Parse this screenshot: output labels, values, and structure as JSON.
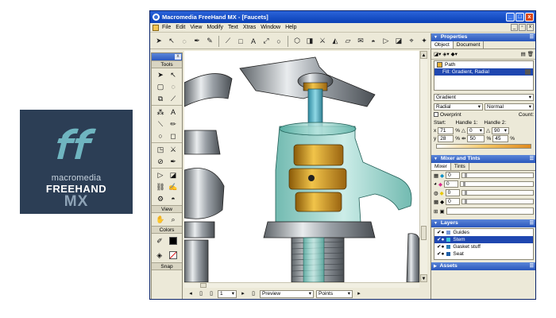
{
  "logo": {
    "line1": "macromedia",
    "line2": "FREEHAND",
    "line3": "MX"
  },
  "window": {
    "title": "Macromedia FreeHand MX - [Faucets]",
    "minimize": "_",
    "maximize": "□",
    "close": "x"
  },
  "menu": [
    "File",
    "Edit",
    "View",
    "Modify",
    "Text",
    "Xtras",
    "Window",
    "Help"
  ],
  "toolbar_icons": [
    "pointer-icon",
    "subselect-icon",
    "lasso-icon",
    "pen-icon",
    "freeform-icon",
    "eyedropper-icon",
    "rectangle-icon",
    "text-icon",
    "scale-icon",
    "ellipse-icon",
    "polygon-icon",
    "extrude-icon",
    "knife-icon",
    "reflect-icon",
    "skew-icon",
    "envelope-icon",
    "bucket-icon",
    "perspective-icon",
    "fill-icon",
    "trace-icon"
  ],
  "tools": {
    "header": "Tools",
    "view_header": "View",
    "colors_header": "Colors",
    "snap_header": "Snap",
    "close": "x"
  },
  "status": {
    "page": "1",
    "preview": "Preview",
    "units": "Points"
  },
  "properties": {
    "title": "Properties",
    "tabs": [
      "Object",
      "Document"
    ],
    "items": [
      "Path",
      "Fill: Gradient, Radial"
    ],
    "fill_type": "Gradient",
    "gradient_type": "Radial",
    "blend": "Normal",
    "overprint": "Overprint",
    "count_label": "Count:",
    "start_label": "Start:",
    "handle1_label": "Handle 1:",
    "handle2_label": "Handle 2:",
    "start_x": "71",
    "start_y": "28",
    "handle1_angle": "0",
    "handle1_len": "50",
    "handle2_angle": "90",
    "handle2_len": "45",
    "x_label": "x",
    "y_label": "y",
    "pct": "%"
  },
  "mixer": {
    "title": "Mixer and Tints",
    "tabs": [
      "Mixer",
      "Tints"
    ],
    "values": [
      "0",
      "0",
      "0",
      "0"
    ]
  },
  "layers": {
    "title": "Layers",
    "items": [
      {
        "name": "Guides",
        "selected": false
      },
      {
        "name": "Stem",
        "selected": true
      },
      {
        "name": "Gasket stuff",
        "selected": false
      },
      {
        "name": "Seat",
        "selected": false
      }
    ]
  },
  "assets": {
    "title": "Assets"
  },
  "colors": {
    "titlebar": "#0b40b6",
    "panel_header": "#2a57bc",
    "selection": "#1f47b0",
    "logo_bg": "#2c3e55",
    "brass": "#d9a023",
    "teal_glass": "#7fcac0",
    "chrome": "#9aa0a6"
  }
}
